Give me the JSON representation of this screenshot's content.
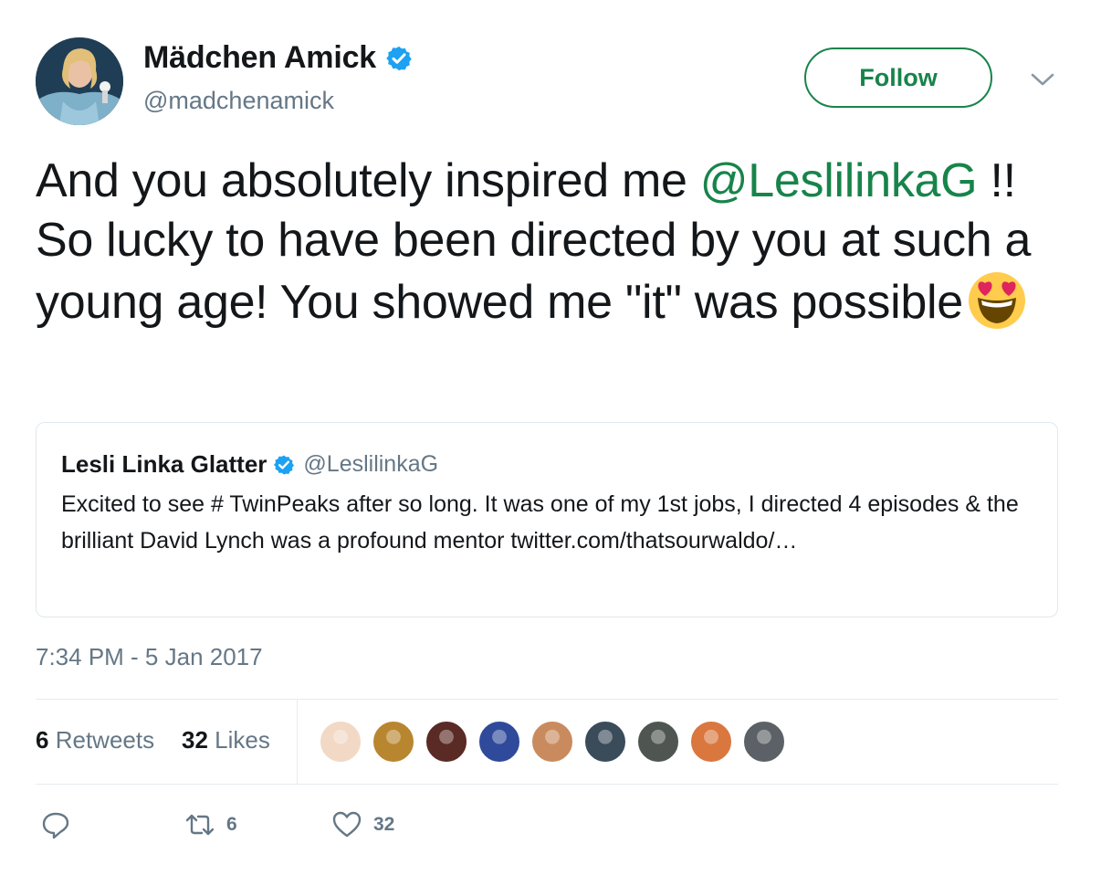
{
  "author": {
    "name": "Mädchen Amick",
    "handle": "@madchenamick",
    "verified": true
  },
  "follow_label": "Follow",
  "tweet": {
    "text_prefix": "And you absolutely inspired me ",
    "mention": "@LeslilinkaG",
    "text_suffix": " !! So lucky to have been directed by you at such a young age! You showed me \"it\" was possible",
    "emoji": "smiling-face-with-heart-eyes"
  },
  "quote": {
    "name": "Lesli Linka Glatter",
    "handle": "@LeslilinkaG",
    "verified": true,
    "text": "Excited to see # TwinPeaks after so long. It was one of my 1st jobs, I directed 4 episodes & the brilliant David Lynch was a profound mentor twitter.com/thatsourwaldo/…"
  },
  "timestamp": "7:34 PM - 5 Jan 2017",
  "stats": {
    "retweets_count": "6",
    "retweets_label": "Retweets",
    "likes_count": "32",
    "likes_label": "Likes"
  },
  "liker_avatars": [
    {
      "color": "#f1d9c6"
    },
    {
      "color": "#b8862f"
    },
    {
      "color": "#5a2a24"
    },
    {
      "color": "#2f4a9a"
    },
    {
      "color": "#c98b5e"
    },
    {
      "color": "#3a4b5a"
    },
    {
      "color": "#4f5652"
    },
    {
      "color": "#d9773f"
    },
    {
      "color": "#5b6166"
    }
  ],
  "actions": {
    "reply_count": "",
    "retweet_count": "6",
    "like_count": "32"
  },
  "colors": {
    "accent": "#17844a",
    "verified": "#1da1f2",
    "muted": "#657786"
  }
}
